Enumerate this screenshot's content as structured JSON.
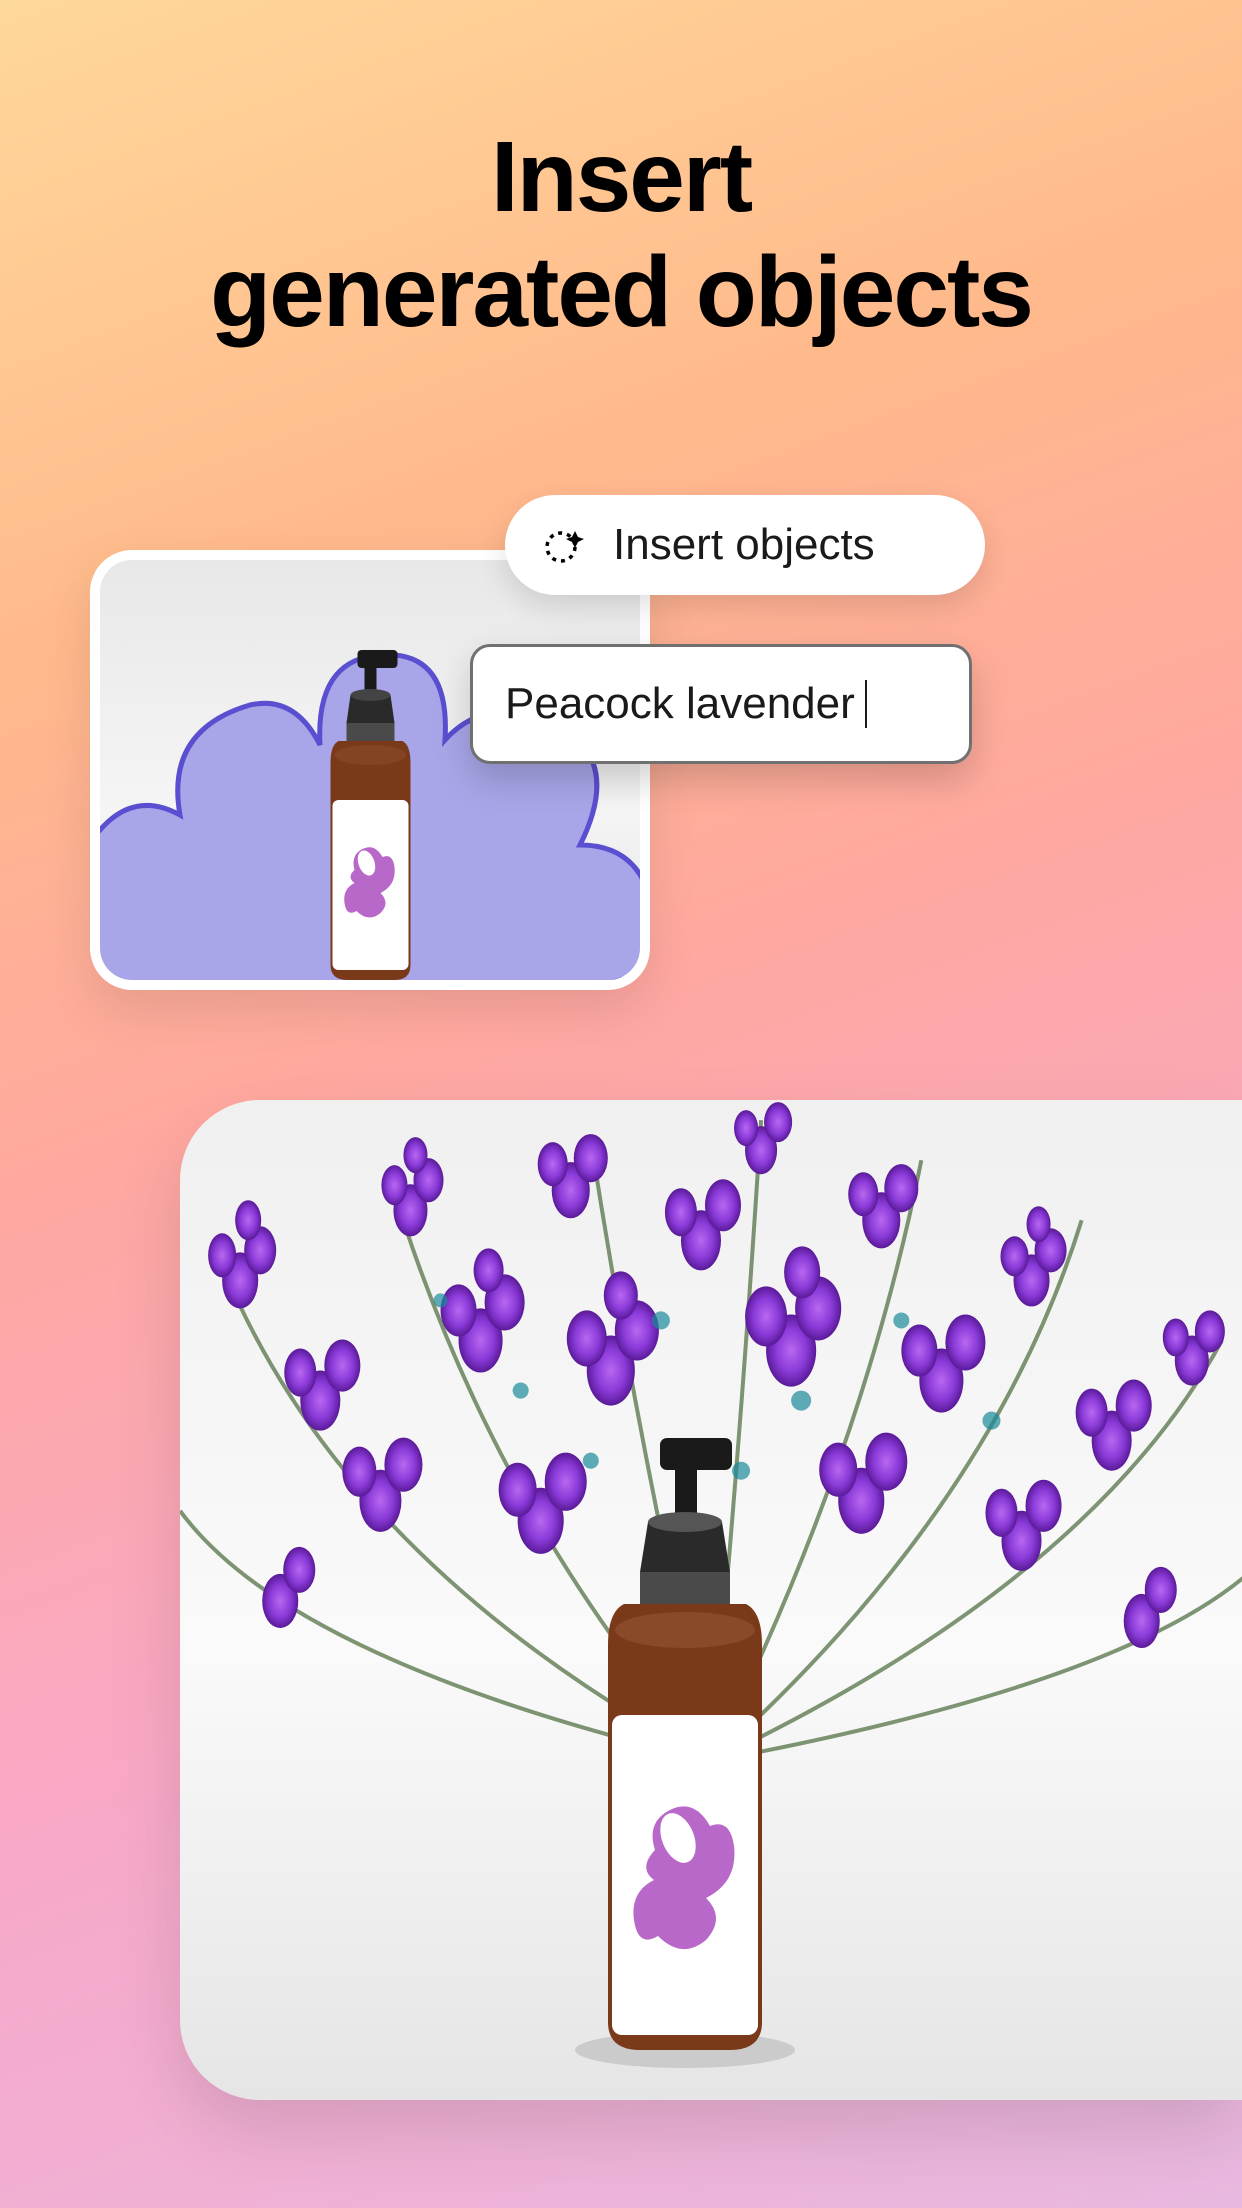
{
  "headline": {
    "line1": "Insert",
    "line2": "generated objects"
  },
  "insert_button": {
    "label": "Insert objects"
  },
  "prompt": {
    "text": "Peacock lavender"
  }
}
